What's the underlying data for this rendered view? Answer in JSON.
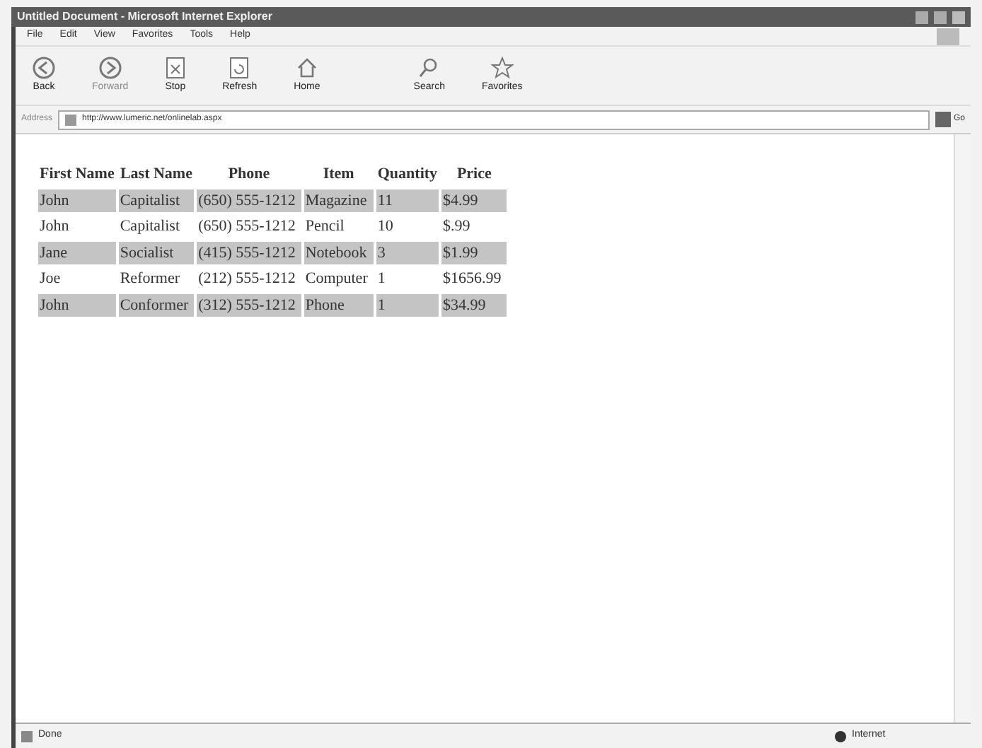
{
  "window": {
    "title": "Untitled Document - Microsoft Internet Explorer"
  },
  "menu": [
    "File",
    "Edit",
    "View",
    "Favorites",
    "Tools",
    "Help"
  ],
  "toolbar": [
    {
      "label": "Back",
      "kind": "back",
      "disabled": false
    },
    {
      "label": "Forward",
      "kind": "forward",
      "disabled": true
    },
    {
      "label": "Stop",
      "kind": "stop",
      "disabled": false
    },
    {
      "label": "Refresh",
      "kind": "refresh",
      "disabled": false
    },
    {
      "label": "Home",
      "kind": "home",
      "disabled": false
    },
    {
      "label": "Search",
      "kind": "search",
      "disabled": false
    },
    {
      "label": "Favorites",
      "kind": "favorites",
      "disabled": false
    }
  ],
  "address": {
    "label": "Address",
    "value": "http://www.lumeric.net/onlinelab.aspx",
    "go": "Go"
  },
  "table": {
    "columns": [
      "First Name",
      "Last Name",
      "Phone",
      "Item",
      "Quantity",
      "Price"
    ],
    "rows": [
      {
        "highlighted": true,
        "cells": [
          "John",
          "Capitalist",
          "(650) 555-1212",
          "Magazine",
          "11",
          "$4.99"
        ]
      },
      {
        "highlighted": false,
        "cells": [
          "John",
          "Capitalist",
          "(650) 555-1212",
          "Pencil",
          "10",
          "$.99"
        ]
      },
      {
        "highlighted": true,
        "cells": [
          "Jane",
          "Socialist",
          "(415) 555-1212",
          "Notebook",
          "3",
          "$1.99"
        ]
      },
      {
        "highlighted": false,
        "cells": [
          "Joe",
          "Reformer",
          "(212) 555-1212",
          "Computer",
          "1",
          "$1656.99"
        ]
      },
      {
        "highlighted": true,
        "cells": [
          "John",
          "Conformer",
          "(312) 555-1212",
          "Phone",
          "1",
          "$34.99"
        ]
      }
    ]
  },
  "status_bar": {
    "text": "Done",
    "zone": "Internet"
  }
}
